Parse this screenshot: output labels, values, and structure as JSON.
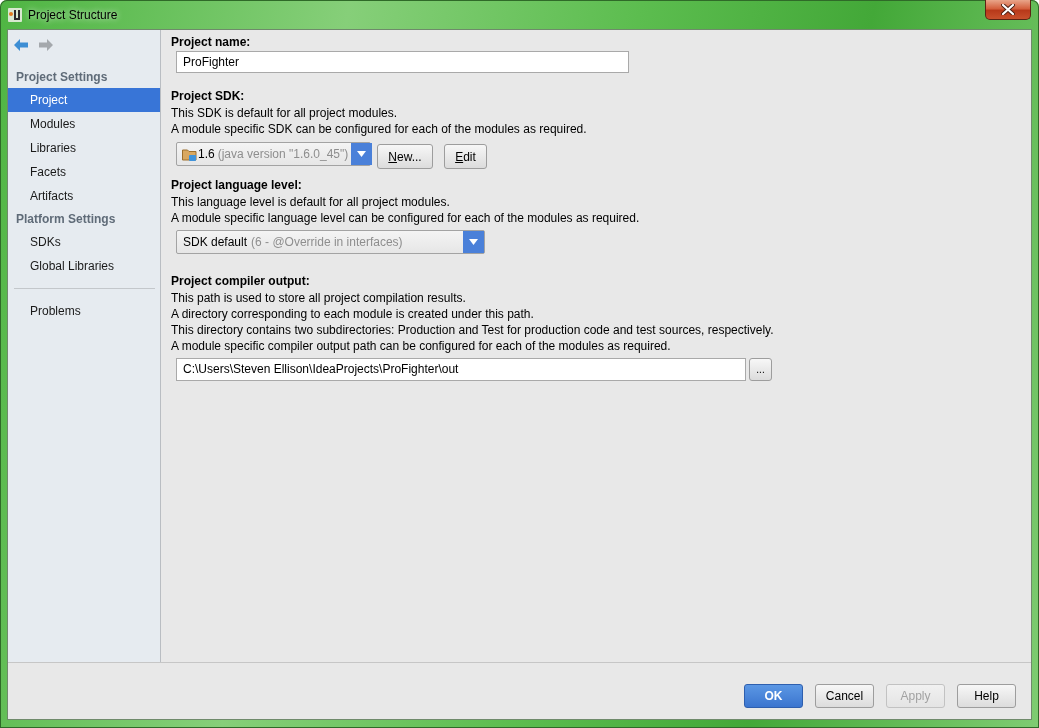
{
  "window": {
    "title": "Project Structure"
  },
  "navigation": [
    {
      "kind": "back",
      "disabled": false
    },
    {
      "kind": "forward",
      "disabled": true
    }
  ],
  "sidebar": {
    "groups": [
      {
        "title": "Project Settings",
        "items": [
          {
            "label": "Project",
            "selected": true
          },
          {
            "label": "Modules",
            "selected": false
          },
          {
            "label": "Libraries",
            "selected": false
          },
          {
            "label": "Facets",
            "selected": false
          },
          {
            "label": "Artifacts",
            "selected": false
          }
        ]
      },
      {
        "title": "Platform Settings",
        "items": [
          {
            "label": "SDKs",
            "selected": false
          },
          {
            "label": "Global Libraries",
            "selected": false
          }
        ]
      }
    ],
    "footer_items": [
      {
        "label": "Problems",
        "selected": false
      }
    ]
  },
  "project_name": {
    "label": "Project name:",
    "value": "ProFighter"
  },
  "project_sdk": {
    "label": "Project SDK:",
    "description": [
      "This SDK is default for all project modules.",
      "A module specific SDK can be configured for each of the modules as required."
    ],
    "dropdown": {
      "value": "1.6",
      "detail": "(java version \"1.6.0_45\")"
    },
    "buttons": [
      {
        "label": "New...",
        "mnemonic": true
      },
      {
        "label": "Edit",
        "mnemonic": true
      }
    ]
  },
  "language_level": {
    "label": "Project language level:",
    "description": [
      "This language level is default for all project modules.",
      "A module specific language level can be configured for each of the modules as required."
    ],
    "dropdown": {
      "value": "SDK default",
      "detail": "(6 - @Override in interfaces)"
    }
  },
  "compiler_output": {
    "label": "Project compiler output:",
    "description": [
      "This path is used to store all project compilation results.",
      "A directory corresponding to each module is created under this path.",
      "This directory contains two subdirectories: Production and Test for production code and test sources, respectively.",
      "A module specific compiler output path can be configured for each of the modules as required."
    ],
    "path": "C:\\Users\\Steven Ellison\\IdeaProjects\\ProFighter\\out",
    "browse_button": "..."
  },
  "dialog_buttons": [
    {
      "label": "OK",
      "primary": true,
      "disabled": false
    },
    {
      "label": "Cancel",
      "primary": false,
      "disabled": false
    },
    {
      "label": "Apply",
      "primary": false,
      "disabled": true
    },
    {
      "label": "Help",
      "primary": false,
      "disabled": false
    }
  ]
}
